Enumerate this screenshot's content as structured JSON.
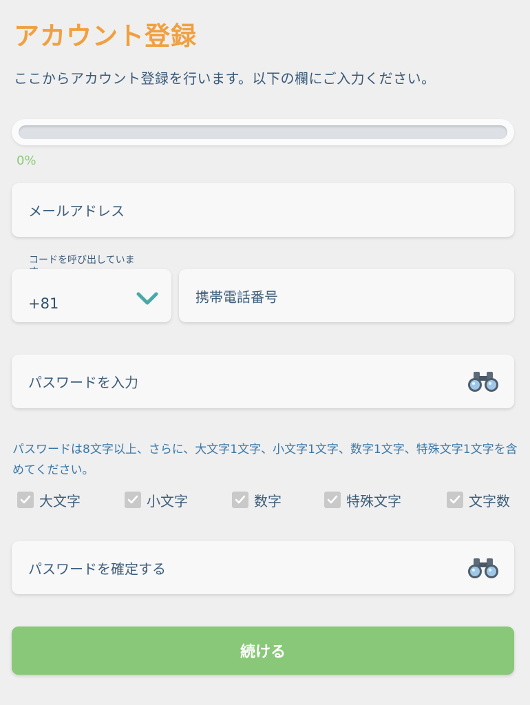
{
  "header": {
    "title": "アカウント登録",
    "subtitle": "ここからアカウント登録を行います。以下の欄にご入力ください。"
  },
  "progress": {
    "value": 0,
    "label": "0%",
    "fill_color": "#8bc97a"
  },
  "form": {
    "email": {
      "placeholder": "メールアドレス"
    },
    "country_code": {
      "caption": "コードを呼び出しています",
      "value": "+81",
      "icon": "chevron-down-icon",
      "icon_color": "#4aa8a8"
    },
    "phone": {
      "placeholder": "携帯電話番号"
    },
    "password": {
      "placeholder": "パスワードを入力",
      "icon": "binoculars-icon"
    },
    "password_hint": "パスワードは8文字以上、さらに、大文字1文字、小文字1文字、数字1文字、特殊文字1文字を含めてください。",
    "requirements": [
      {
        "label": "大文字",
        "checked": true
      },
      {
        "label": "小文字",
        "checked": true
      },
      {
        "label": "数字",
        "checked": true
      },
      {
        "label": "特殊文字",
        "checked": true
      },
      {
        "label": "文字数",
        "checked": true
      }
    ],
    "confirm_password": {
      "placeholder": "パスワードを確定する",
      "icon": "binoculars-icon"
    }
  },
  "actions": {
    "continue_label": "続ける",
    "continue_color": "#88c878"
  },
  "colors": {
    "title": "#f0a040",
    "background": "#efefef",
    "text": "#3d5d7a",
    "hint": "#3a78a8"
  }
}
